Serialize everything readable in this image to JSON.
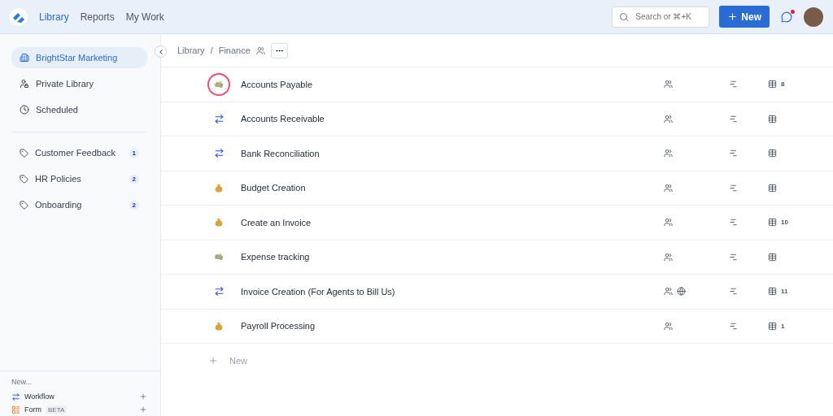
{
  "nav": {
    "tabs": [
      {
        "label": "Library",
        "selected": true
      },
      {
        "label": "Reports",
        "selected": false
      },
      {
        "label": "My Work",
        "selected": false
      }
    ],
    "search": {
      "placeholder": "Search or ⌘+K"
    },
    "new_button": "New",
    "notifications_unread": true
  },
  "sidebar": {
    "items": [
      {
        "label": "BrightStar Marketing",
        "kind": "building",
        "selected": true
      },
      {
        "label": "Private Library",
        "kind": "private",
        "selected": false
      },
      {
        "label": "Scheduled",
        "kind": "clock",
        "selected": false
      }
    ],
    "tags": [
      {
        "label": "Customer Feedback",
        "count": "1"
      },
      {
        "label": "HR Policies",
        "count": "2"
      },
      {
        "label": "Onboarding",
        "count": "2"
      }
    ],
    "new_section": {
      "title": "New...",
      "items": [
        {
          "label": "Workflow",
          "kind": "workflow"
        },
        {
          "label": "Form",
          "kind": "form",
          "badge": "BETA"
        }
      ]
    }
  },
  "breadcrumb": [
    "Library",
    "Finance"
  ],
  "breadcrumb_separator": "/",
  "rows": [
    {
      "name": "Accounts Payable",
      "kind": "bills",
      "highlighted": true,
      "public": false,
      "count": "8"
    },
    {
      "name": "Accounts Receivable",
      "kind": "workflow",
      "highlighted": false,
      "public": false
    },
    {
      "name": "Bank Reconciliation",
      "kind": "workflow",
      "highlighted": false,
      "public": false
    },
    {
      "name": "Budget Creation",
      "kind": "moneybag",
      "highlighted": false,
      "public": false
    },
    {
      "name": "Create an Invoice",
      "kind": "moneybag",
      "highlighted": false,
      "public": false,
      "count": "10"
    },
    {
      "name": "Expense tracking",
      "kind": "bills",
      "highlighted": false,
      "public": false
    },
    {
      "name": "Invoice Creation (For Agents to Bill Us)",
      "kind": "workflow",
      "highlighted": false,
      "public": true,
      "count": "11"
    },
    {
      "name": "Payroll Processing",
      "kind": "moneybag",
      "highlighted": false,
      "public": false,
      "count": "1"
    }
  ],
  "new_row": "New"
}
